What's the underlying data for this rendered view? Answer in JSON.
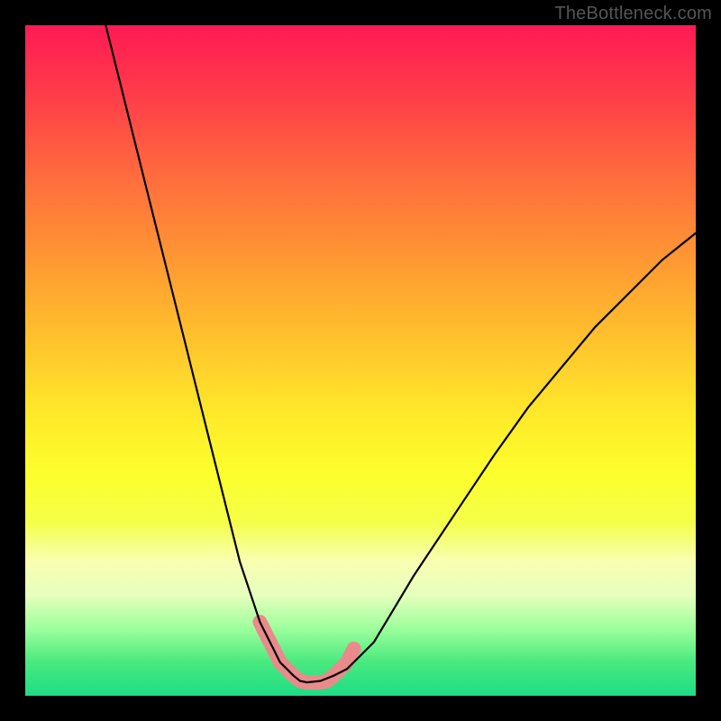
{
  "watermark": "TheBottleneck.com",
  "chart_data": {
    "type": "line",
    "title": "",
    "xlabel": "",
    "ylabel": "",
    "xlim": [
      0,
      100
    ],
    "ylim": [
      0,
      100
    ],
    "series": [
      {
        "name": "left-curve",
        "x": [
          12,
          14,
          16,
          18,
          20,
          22,
          24,
          26,
          28,
          30,
          32,
          34,
          35,
          36,
          37,
          38,
          39,
          40,
          41,
          42
        ],
        "y": [
          100,
          92,
          84,
          76,
          68,
          60,
          52,
          44,
          36,
          28,
          20,
          14,
          11,
          9,
          7,
          5,
          4,
          3,
          2.2,
          2
        ]
      },
      {
        "name": "right-curve",
        "x": [
          42,
          44,
          46,
          48,
          50,
          52,
          55,
          58,
          62,
          66,
          70,
          75,
          80,
          85,
          90,
          95,
          100
        ],
        "y": [
          2,
          2.2,
          3,
          4,
          6,
          8,
          13,
          18,
          24,
          30,
          36,
          43,
          49,
          55,
          60,
          65,
          69
        ]
      },
      {
        "name": "pink-marker-region",
        "x": [
          35,
          36,
          37,
          38,
          39,
          40,
          41,
          42,
          43,
          44,
          45,
          46,
          47,
          48,
          49
        ],
        "y": [
          11,
          9,
          7,
          5,
          4,
          3,
          2.2,
          2,
          2,
          2,
          2.2,
          3,
          4,
          5,
          7
        ]
      }
    ],
    "colors": {
      "curve": "#000000",
      "marker": "#e98b8b",
      "gradient_top": "#ff1a54",
      "gradient_mid": "#ffe92a",
      "gradient_bottom": "#1edc86"
    }
  }
}
